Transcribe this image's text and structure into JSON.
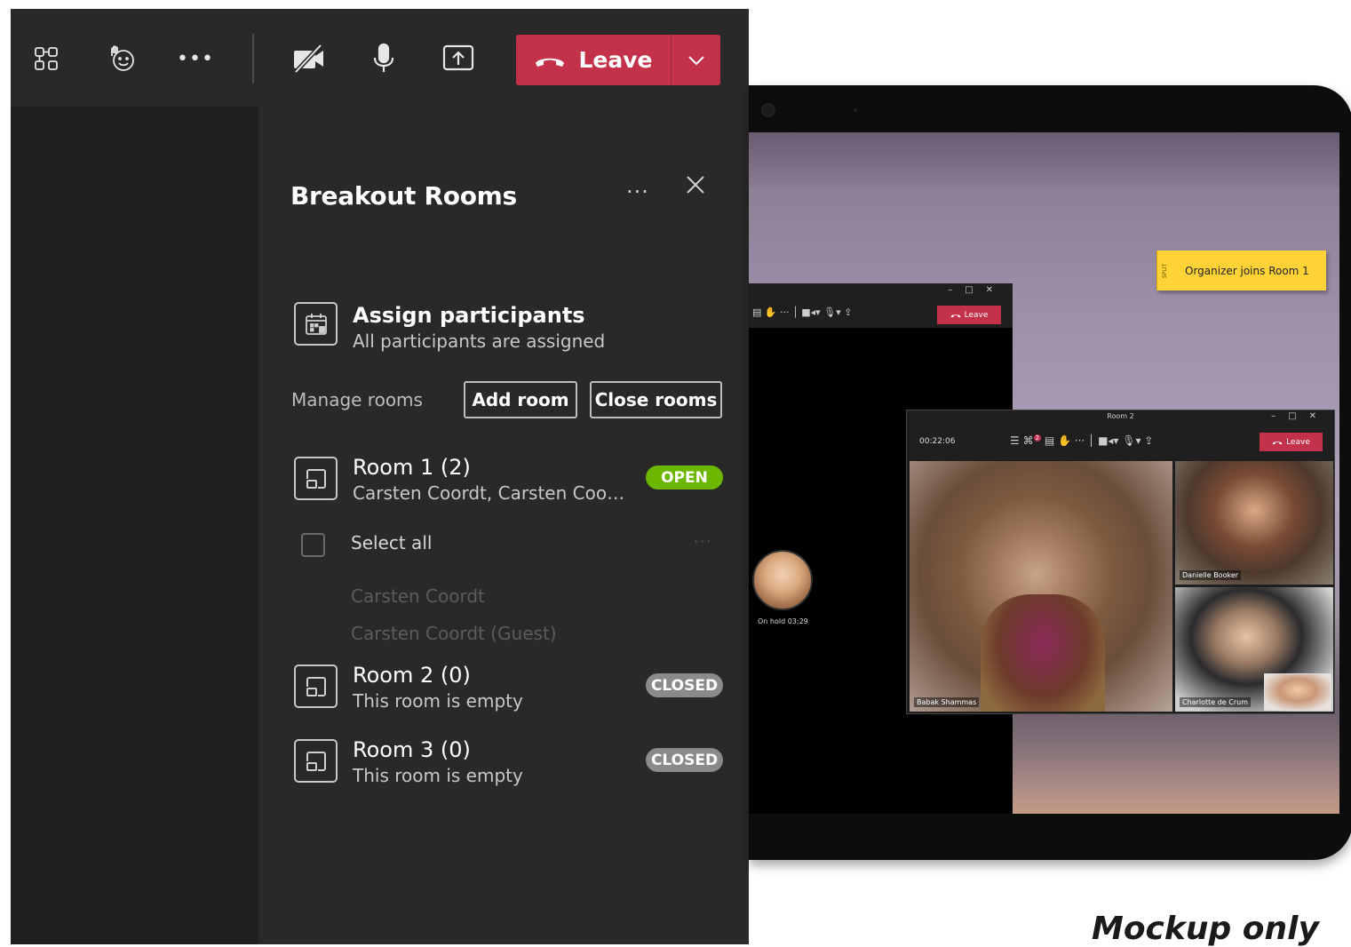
{
  "toolbar": {
    "leave_label": "Leave",
    "icons": [
      "breakout-rooms-icon",
      "reactions-icon",
      "more-icon",
      "camera-off-icon",
      "microphone-icon",
      "share-screen-icon",
      "hang-up-icon",
      "chevron-down-icon"
    ],
    "more_glyph": "•••",
    "leave_color": "#c4314b"
  },
  "breakout": {
    "title": "Breakout Rooms",
    "more_glyph": "···",
    "assign": {
      "title": "Assign participants",
      "subtitle": "All participants are assigned"
    },
    "manage_label": "Manage rooms",
    "add_room_label": "Add room",
    "close_rooms_label": "Close rooms",
    "rooms": [
      {
        "name": "Room 1 (2)",
        "subtitle": "Carsten Coordt, Carsten Coordt ...",
        "status": "OPEN",
        "select_all_label": "Select all",
        "participants": [
          "Carsten Coordt",
          "Carsten Coordt (Guest)"
        ]
      },
      {
        "name": "Room 2 (0)",
        "subtitle": "This room is empty",
        "status": "CLOSED"
      },
      {
        "name": "Room 3 (0)",
        "subtitle": "This room is empty",
        "status": "CLOSED"
      }
    ],
    "colors": {
      "open": "#6bb700",
      "closed": "#8a8a8a",
      "panel": "#292929"
    }
  },
  "tablet": {
    "sticky": {
      "tag": "SPLIT",
      "text": "Organizer joins Room 1"
    },
    "window_back": {
      "leave_label": "Leave",
      "hold_label": "On hold 03:29"
    },
    "window_front": {
      "title": "Room 2",
      "timer": "00:22:06",
      "leave_label": "Leave",
      "notification_count": "2",
      "participants": [
        "Babak Shammas",
        "Danielle Booker",
        "Charlotte de Crum"
      ]
    }
  },
  "caption": "Mockup only"
}
